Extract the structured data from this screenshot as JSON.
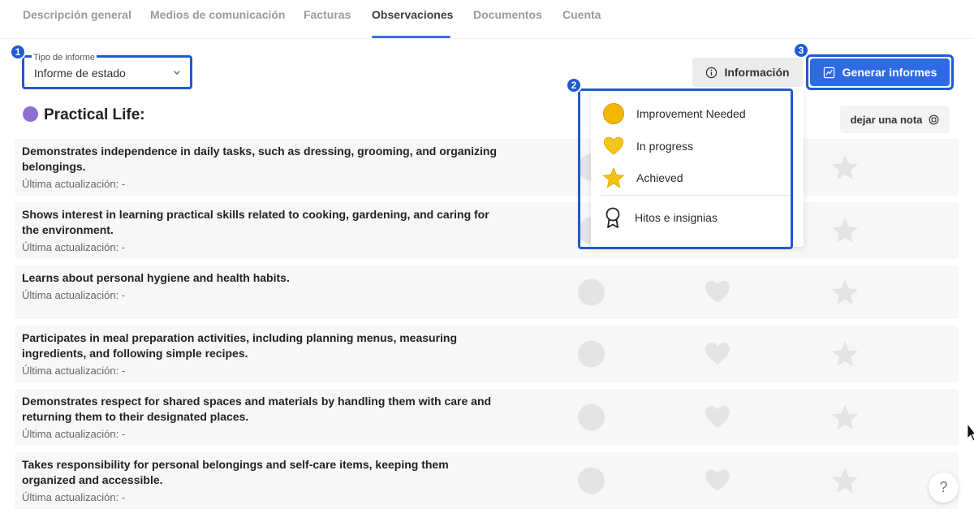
{
  "tabs": [
    {
      "label": "Descripción general",
      "active": false
    },
    {
      "label": "Medios de comunicación",
      "active": false
    },
    {
      "label": "Facturas",
      "active": false
    },
    {
      "label": "Observaciones",
      "active": true
    },
    {
      "label": "Documentos",
      "active": false
    },
    {
      "label": "Cuenta",
      "active": false
    }
  ],
  "steps": [
    "1",
    "2",
    "3"
  ],
  "report_type": {
    "label": "Tipo de informe",
    "value": "Informe de estado"
  },
  "info_button": {
    "label": "Información",
    "icon": "info-icon"
  },
  "generate_button": {
    "label": "Generar informes",
    "icon": "chart-icon"
  },
  "section": {
    "title": "Practical Life:",
    "color": "#8b6fd1"
  },
  "note_button": {
    "label": "dejar una nota",
    "icon": "note-icon"
  },
  "legend": {
    "items": [
      {
        "label": "Improvement Needed",
        "icon": "yellow-circle-icon"
      },
      {
        "label": "In progress",
        "icon": "yellow-heart-icon"
      },
      {
        "label": "Achieved",
        "icon": "star-icon"
      }
    ],
    "milestones": {
      "label": "Hitos e insignias",
      "icon": "ribbon-icon"
    }
  },
  "rows": [
    {
      "text": "Demonstrates independence in daily tasks, such as dressing, grooming, and organizing belongings.",
      "meta": "Última actualización: -"
    },
    {
      "text": "Shows interest in learning practical skills related to cooking, gardening, and caring for the environment.",
      "meta": "Última actualización: -"
    },
    {
      "text": "Learns about personal hygiene and health habits.",
      "meta": "Última actualización: -"
    },
    {
      "text": "Participates in meal preparation activities, including planning menus, measuring ingredients, and following simple recipes.",
      "meta": "Última actualización: -"
    },
    {
      "text": "Demonstrates respect for shared spaces and materials by handling them with care and returning them to their designated places.",
      "meta": "Última actualización: -"
    },
    {
      "text": "Takes responsibility for personal belongings and self-care items, keeping them organized and accessible.",
      "meta": "Última actualización: -"
    }
  ],
  "help_button": {
    "label": "?"
  },
  "colors": {
    "accent": "#2e6be2",
    "highlight": "#1f5ad1",
    "rating_gray": "#e4e4e4",
    "improvement": "#f2b705",
    "in_progress": "#f5c518",
    "achieved": "#f4c20d"
  }
}
